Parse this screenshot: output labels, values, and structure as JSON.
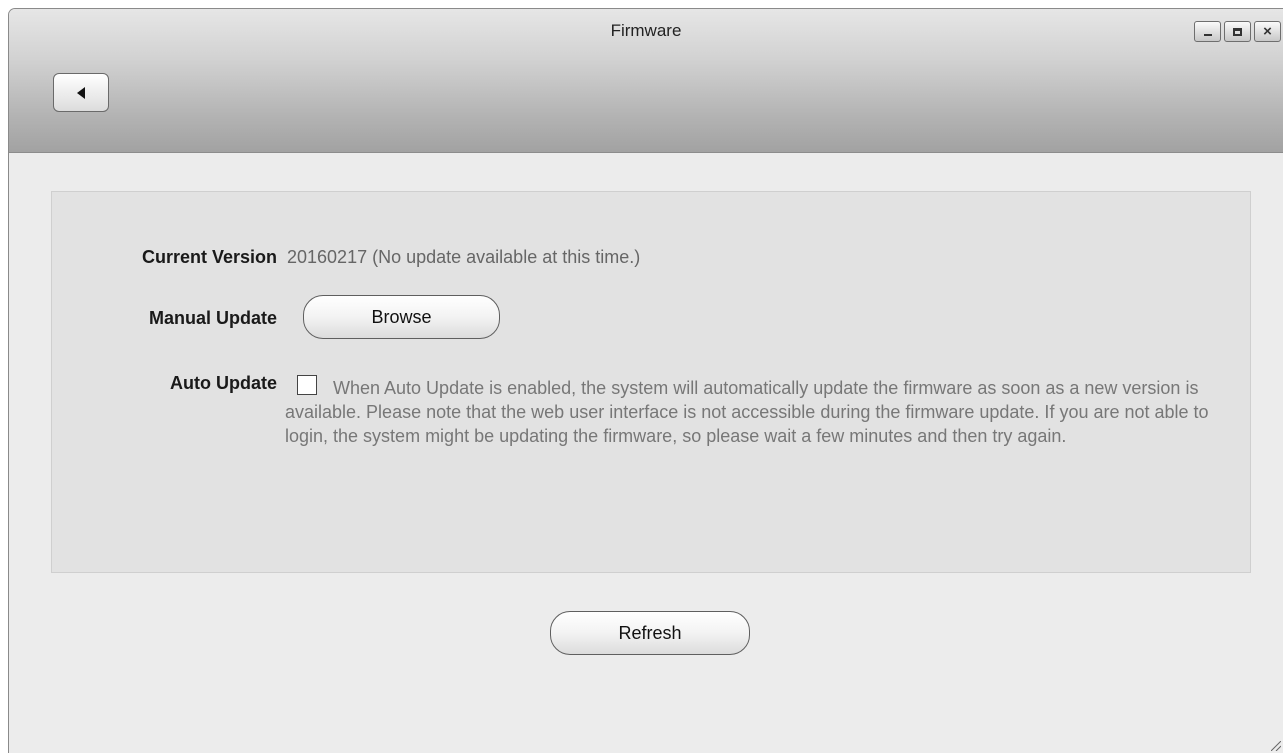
{
  "window": {
    "title": "Firmware",
    "controls": {
      "minimize": "minimize-icon",
      "maximize": "maximize-icon",
      "close": "close-icon"
    },
    "close_glyph": "×",
    "back_icon": "back-arrow-icon"
  },
  "firmware": {
    "current_version_label": "Current Version",
    "current_version_value": "20160217 (No update available at this time.)",
    "manual_update_label": "Manual Update",
    "browse_label": "Browse",
    "auto_update_label": "Auto Update",
    "auto_update_checked": false,
    "auto_update_description": "When Auto Update is enabled, the system will automatically update the firmware as soon as a new version is available. Please note that the web user interface is not accessible during the firmware update. If you are not able to login, the system might be updating the firmware, so please wait a few minutes and then try again."
  },
  "footer": {
    "refresh_label": "Refresh"
  },
  "colors": {
    "window_bg": "#ececec",
    "panel_bg": "#e2e2e2",
    "label_text": "#1a1a1a",
    "value_text": "#666666"
  }
}
